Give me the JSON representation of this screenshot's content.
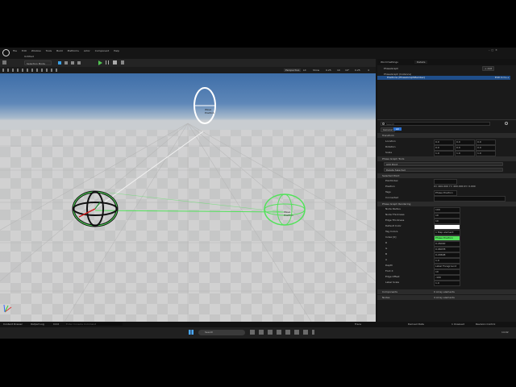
{
  "menu": [
    "File",
    "Edit",
    "Window",
    "Tools",
    "Build",
    "Platforms",
    "Actor",
    "Component",
    "Help"
  ],
  "project_tab": "Untitled",
  "toolbar": {
    "mode": "Selection Mode"
  },
  "viewport": {
    "perspective": "Perspective",
    "view_mode": "Lit",
    "show": "Show",
    "speed": "0.25",
    "grid": "10",
    "angle": "10°",
    "scale": "0.25",
    "cam": "4"
  },
  "gizmos": [
    {
      "label": "Wave\nPosition"
    },
    {
      "label": "Wave\nPosition"
    }
  ],
  "panel": {
    "tab_world": "World Settings",
    "tab_details": "Details",
    "tab_graph": "PhaseGraph",
    "add_button": "+ Add",
    "tree_root": "PhaseGraph (Instance)",
    "tree_child": "Positions (PhaseGraphMember)",
    "tree_child_note": "Edit in C++",
    "search_placeholder": "Search",
    "filter_general": "General",
    "filter_all": "All",
    "section_transform": "Transform",
    "transform_rows": [
      {
        "label": "Location",
        "x": "0.0",
        "y": "0.0",
        "z": "0.0"
      },
      {
        "label": "Rotation",
        "x": "0.0",
        "y": "0.0",
        "z": "0.0"
      },
      {
        "label": "Scale",
        "x": "1.0",
        "y": "1.0",
        "z": "1.0"
      }
    ],
    "section_tools": "Phase Graph Tools",
    "tools_add": "Add Point",
    "tools_delete": "Delete Selected",
    "section_selected": "Selected Point",
    "selected_rows": [
      {
        "label": "PointIndex",
        "value": ""
      },
      {
        "label": "Position",
        "value": "X= 400.000 Y= 400.000 Z= 0.000"
      },
      {
        "label": "Tags",
        "value": "Phase Position"
      },
      {
        "label": "Connected",
        "value": ""
      }
    ],
    "section_render": "Phase Graph Rendering",
    "render_rows": [
      {
        "label": "Node Radius",
        "value": "100"
      },
      {
        "label": "Node Thickness",
        "value": "10"
      },
      {
        "label": "Edge Thickness",
        "value": "10"
      },
      {
        "label": "Default Color",
        "value": ""
      },
      {
        "label": "Tag Colors",
        "value": "1 Map element"
      },
      {
        "label": "Index [0]",
        "value": "Phase Position"
      },
      {
        "label": "R",
        "value": "0.26000"
      },
      {
        "label": "G",
        "value": "0.96078"
      },
      {
        "label": "B",
        "value": "0.29608"
      },
      {
        "label": "A",
        "value": "1.0"
      },
      {
        "label": "Depth",
        "value": "Label Foreground"
      },
      {
        "label": "Font X",
        "value": "10"
      },
      {
        "label": "Edge Offset",
        "value": "-100"
      },
      {
        "label": "Label Scale",
        "value": "1.0"
      }
    ],
    "section_components": "Components",
    "components_value": "0 Array elements",
    "section_nodes": "Nodes",
    "nodes_value": "4 Array elements"
  },
  "bottom_bar": {
    "content_drawer": "Content Drawer",
    "output_log": "Output Log",
    "cmd": "Cmd",
    "console_placeholder": "Enter Console Command",
    "trace": "Trace",
    "derived": "Derived Data",
    "unsaved": "1 Unsaved",
    "revision": "Revision Control"
  },
  "taskbar": {
    "search": "Search",
    "time": "14:02"
  },
  "colors": {
    "accent_green": "#52e25a",
    "selection_blue": "#1f4e8a"
  }
}
